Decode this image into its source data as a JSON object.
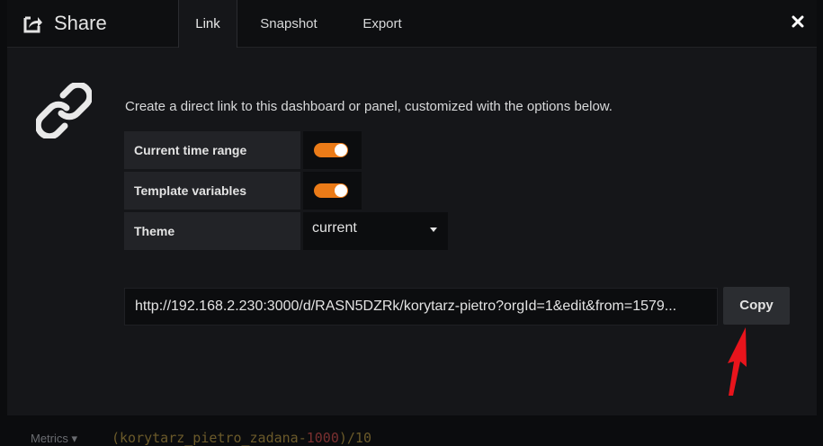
{
  "header": {
    "title": "Share",
    "tabs": [
      "Link",
      "Snapshot",
      "Export"
    ],
    "active_tab": "Link"
  },
  "link": {
    "description": "Create a direct link to this dashboard or panel, customized with the options below.",
    "options": [
      {
        "label": "Current time range",
        "type": "switch",
        "checked": true
      },
      {
        "label": "Template variables",
        "type": "switch",
        "checked": true
      },
      {
        "label": "Theme",
        "type": "select",
        "value": "current"
      }
    ],
    "url": "http://192.168.2.230:3000/d/RASN5DZRk/korytarz-pietro?orgId=1&edit&from=1579...",
    "copy_label": "Copy"
  },
  "background": {
    "metrics_label": "Metrics ▾",
    "query_prefix": "(korytarz_pietro_zadana-",
    "query_number": "1000",
    "query_suffix": ")/10"
  },
  "colors": {
    "accent": "#eb7b18",
    "arrow": "#e8141c",
    "modal_bg": "#151619",
    "header_bg": "#0e0f11"
  },
  "icons": {
    "share": "share-icon",
    "link": "chain-link-icon",
    "close": "close-icon",
    "caret": "caret-down-icon"
  }
}
